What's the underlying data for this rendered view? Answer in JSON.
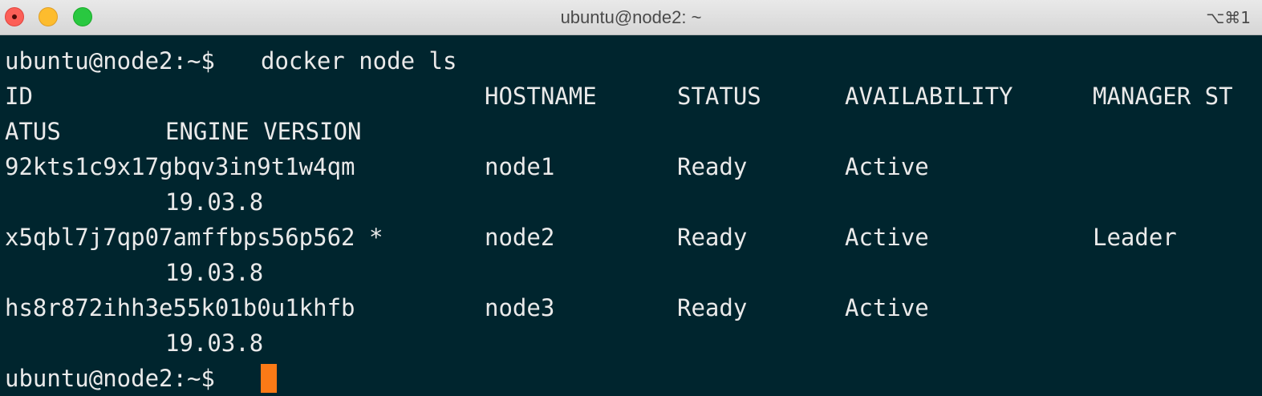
{
  "window": {
    "title": "ubuntu@node2: ~",
    "shortcut": "⌥⌘1"
  },
  "terminal": {
    "prompt": "ubuntu@node2:~$",
    "command": "docker node ls",
    "header": {
      "id": "ID",
      "hostname": "HOSTNAME",
      "status": "STATUS",
      "availability": "AVAILABILITY",
      "manager_status_part1": "MANAGER ST",
      "manager_status_part2": "ATUS",
      "engine_version": "ENGINE VERSION"
    },
    "rows": [
      {
        "id": "92kts1c9x17gbqv3in9t1w4qm",
        "hostname": "node1",
        "status": "Ready",
        "availability": "Active",
        "manager_status": "",
        "engine_version": "19.03.8"
      },
      {
        "id": "x5qbl7j7qp07amffbps56p562 *",
        "hostname": "node2",
        "status": "Ready",
        "availability": "Active",
        "manager_status": "Leader",
        "engine_version": "19.03.8"
      },
      {
        "id": "hs8r872ihh3e55k01b0u1khfb",
        "hostname": "node3",
        "status": "Ready",
        "availability": "Active",
        "manager_status": "",
        "engine_version": "19.03.8"
      }
    ],
    "final_prompt": "ubuntu@node2:~$",
    "cursor_color": "#fb7a16"
  }
}
